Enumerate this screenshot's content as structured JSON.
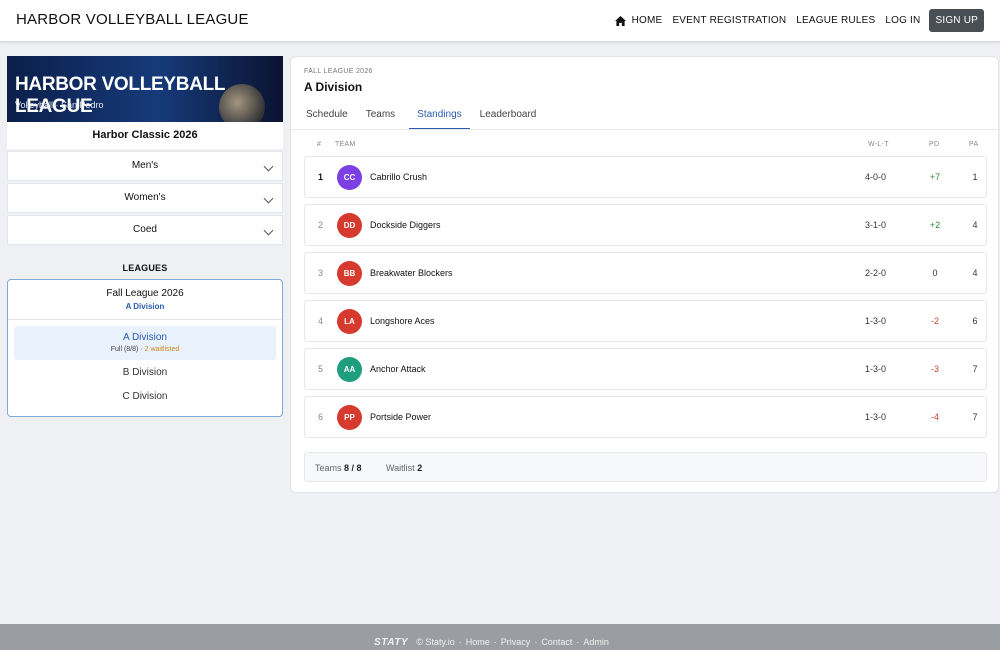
{
  "header": {
    "brand": "HARBOR VOLLEYBALL LEAGUE",
    "nav": {
      "home": "HOME",
      "event_registration": "EVENT REGISTRATION",
      "league_rules": "LEAGUE RULES",
      "log_in": "LOG IN",
      "sign_up": "SIGN UP"
    }
  },
  "sidebar": {
    "banner_title": "HARBOR VOLLEYBALL LEAGUE",
    "banner_subtitle": "Volleyball · San Pedro",
    "event_name": "Harbor Classic 2026",
    "categories": [
      "Men's",
      "Women's",
      "Coed"
    ],
    "leagues_heading": "LEAGUES",
    "league": {
      "name": "Fall League 2026",
      "selected_division": "A Division",
      "active_division": {
        "title": "A Division",
        "status": "Full (8/8)",
        "separator": " · ",
        "waitlist": "2 waitlisted"
      },
      "other_divisions": [
        "B Division",
        "C Division"
      ]
    }
  },
  "main": {
    "breadcrumb": "FALL LEAGUE 2026",
    "title": "A Division",
    "tabs": [
      "Schedule",
      "Teams",
      "Standings",
      "Leaderboard"
    ],
    "active_tab": "Standings",
    "table": {
      "headers": {
        "rank": "#",
        "team": "TEAM",
        "wlt": "W-L-T",
        "pd": "PD",
        "pa": "PA"
      },
      "rows": [
        {
          "rank": "1",
          "initials": "CC",
          "team": "Cabrillo Crush",
          "wlt": "4-0-0",
          "pd": "+7",
          "pa": "1",
          "color": "#7b3fe4"
        },
        {
          "rank": "2",
          "initials": "DD",
          "team": "Dockside Diggers",
          "wlt": "3-1-0",
          "pd": "+2",
          "pa": "4",
          "color": "#d63a2f"
        },
        {
          "rank": "3",
          "initials": "BB",
          "team": "Breakwater Blockers",
          "wlt": "2-2-0",
          "pd": "0",
          "pa": "4",
          "color": "#d63a2f"
        },
        {
          "rank": "4",
          "initials": "LA",
          "team": "Longshore Aces",
          "wlt": "1-3-0",
          "pd": "-2",
          "pa": "6",
          "color": "#d63a2f"
        },
        {
          "rank": "5",
          "initials": "AA",
          "team": "Anchor Attack",
          "wlt": "1-3-0",
          "pd": "-3",
          "pa": "7",
          "color": "#1e9e7e"
        },
        {
          "rank": "6",
          "initials": "PP",
          "team": "Portside Power",
          "wlt": "1-3-0",
          "pd": "-4",
          "pa": "7",
          "color": "#d63a2f"
        }
      ]
    },
    "summary": {
      "teams_label": "Teams",
      "teams_value": "8 / 8",
      "waitlist_label": "Waitlist",
      "waitlist_value": "2"
    }
  },
  "footer": {
    "logo": "STATY",
    "copyright": "© Staty.io",
    "links": [
      "Home",
      "Privacy",
      "Contact",
      "Admin"
    ]
  },
  "colors": {
    "accent": "#2a5db0",
    "positive": "#2e8b3a",
    "negative": "#d23b30",
    "waitlist": "#d08a1a"
  },
  "icons": {
    "home": "home-icon",
    "chevron": "chevron-down-icon"
  }
}
